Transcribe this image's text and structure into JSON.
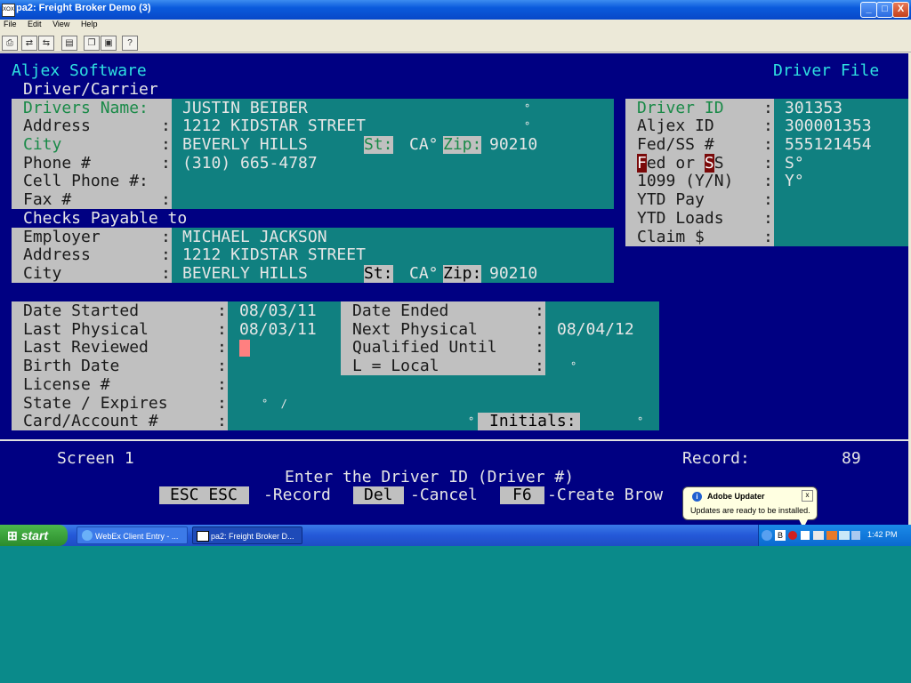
{
  "window": {
    "title": "pa2: Freight Broker Demo (3)",
    "icon_label": "XOX",
    "controls": [
      "_",
      "□",
      "X"
    ]
  },
  "menu": [
    "File",
    "Edit",
    "View",
    "Help"
  ],
  "toolbar_icons": [
    "print-setup-icon",
    "connect-icon",
    "disconnect-icon",
    "print-icon",
    "copy-icon",
    "paste-icon",
    "help-icon"
  ],
  "header": {
    "left": "Aljex Software",
    "right": "Driver File"
  },
  "carrier": {
    "section_title": "Driver/Carrier",
    "labels": {
      "name": "Drivers Name:",
      "address": "Address",
      "city": "City",
      "phone": "Phone #",
      "cell": "Cell Phone #:",
      "fax": "Fax #",
      "st": "St:",
      "zip": "Zip:"
    },
    "name": "JUSTIN BEIBER",
    "address": "1212 KIDSTAR STREET",
    "city": "BEVERLY HILLS",
    "state": "CA°",
    "zip": "90210",
    "phone": "(310) 665-4787"
  },
  "payable": {
    "section_title": "Checks Payable to",
    "labels": {
      "employer": "Employer",
      "address": "Address",
      "city": "City",
      "st": "St:",
      "zip": "Zip:"
    },
    "employer": "MICHAEL JACKSON",
    "address": "1212 KIDSTAR STREET",
    "city": "BEVERLY HILLS",
    "state": "CA°",
    "zip": "90210"
  },
  "driver_info": {
    "labels": {
      "driver_id": "Driver ID",
      "aljex_id": "Aljex ID",
      "fedss": "Fed/SS #",
      "fed_or_ss_1": "ed or ",
      "fed_or_ss_f": "F",
      "fed_or_ss_s": "S",
      "fed_or_ss_end": "S",
      "form1099": "1099 (Y/N)",
      "ytd_pay": "YTD Pay",
      "ytd_loads": "YTD Loads",
      "claim": "Claim $"
    },
    "driver_id": "301353",
    "aljex_id": "300001353",
    "fedss": "555121454",
    "fed_or_ss": "S°",
    "form1099": "Y°"
  },
  "dates": {
    "labels": {
      "date_started": "Date Started",
      "last_physical": "Last Physical",
      "last_reviewed": "Last Reviewed",
      "birth_date": "Birth Date",
      "license": "License #",
      "state_expires": "State / Expires",
      "card_account": "Card/Account #",
      "date_ended": "Date Ended",
      "next_physical": "Next Physical",
      "qualified_until": "Qualified Until",
      "local": "L = Local",
      "initials": "Initials:"
    },
    "date_started": "08/03/11",
    "last_physical": "08/03/11",
    "next_physical": "08/04/12",
    "state_expires": "°  /"
  },
  "footer": {
    "screen": "Screen 1",
    "record_label": "Record:",
    "record_value": "89",
    "prompt": "Enter the Driver ID (Driver #)",
    "keys": [
      {
        "key": "ESC ESC",
        "action": "-Record"
      },
      {
        "key": "Del",
        "action": "-Cancel"
      },
      {
        "key": "F6",
        "action": "-Create Brow"
      }
    ]
  },
  "notification": {
    "title": "Adobe Updater",
    "message": "Updates are ready to be installed.",
    "close": "x"
  },
  "taskbar": {
    "start": "start",
    "tasks": [
      "WebEx Client Entry - ...",
      "pa2: Freight Broker D..."
    ],
    "clock": "1:42 PM"
  },
  "colors": {
    "terminal_bg": "#000082",
    "field_bg": "#108080",
    "label_bg": "#c0c0c0",
    "desktop": "#0a8a8a"
  }
}
